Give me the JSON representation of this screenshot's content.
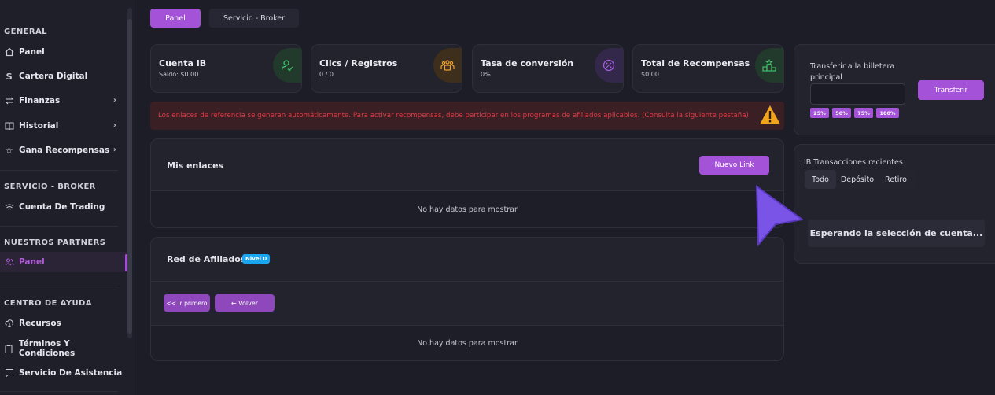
{
  "sidebar": {
    "sections": [
      {
        "title": "GENERAL"
      },
      {
        "title": "SERVICIO - BROKER"
      },
      {
        "title": "NUESTROS PARTNERS"
      },
      {
        "title": "CENTRO DE AYUDA"
      }
    ],
    "items": [
      {
        "label": "Panel",
        "icon": "home-icon"
      },
      {
        "label": "Cartera Digital",
        "icon": "dollar-icon"
      },
      {
        "label": "Finanzas",
        "icon": "exchange-icon",
        "chevron": "›"
      },
      {
        "label": "Historial",
        "icon": "book-icon",
        "chevron": "›"
      },
      {
        "label": "Gana Recompensas",
        "icon": "star-icon",
        "chevron": "›"
      },
      {
        "label": "Cuenta De Trading",
        "icon": "trading-icon"
      },
      {
        "label": "Panel",
        "icon": "partners-icon",
        "active": true
      },
      {
        "label": "Recursos",
        "icon": "download-cloud-icon"
      },
      {
        "label": "Términos Y Condiciones",
        "icon": "clipboard-icon"
      },
      {
        "label": "Servicio De Asistencia",
        "icon": "chat-icon"
      }
    ]
  },
  "tabs": [
    {
      "label": "Panel",
      "active": true
    },
    {
      "label": "Servicio - Broker",
      "active": false
    }
  ],
  "stats": [
    {
      "title": "Cuenta IB",
      "sub": "Saldo: $0.00",
      "icon": "user-check-icon",
      "color": "#3fbf6a"
    },
    {
      "title": "Clics / Registros",
      "sub": "0 / 0",
      "icon": "users-icon",
      "color": "#f2a12a"
    },
    {
      "title": "Tasa de conversión",
      "sub": "0%",
      "icon": "percent-badge-icon",
      "color": "#a45ce0"
    },
    {
      "title": "Total de Recompensas",
      "sub": "$0.00",
      "icon": "podium-icon",
      "color": "#3fbf6a"
    }
  ],
  "alert": {
    "text": "Los enlaces de referencia se generan automáticamente. Para activar recompensas, debe participar en los programas de afiliados aplicables. (Consulta la siguiente pestaña)",
    "icon": "warning-icon"
  },
  "links_panel": {
    "title": "Mis enlaces",
    "new_button": "Nuevo Link",
    "empty": "No hay datos para mostrar"
  },
  "affiliates_panel": {
    "title": "Red de Afiliados",
    "level_badge": "Nivel 0",
    "first_button": "<< Ir primero",
    "back_button": "← Volver",
    "empty": "No hay datos para mostrar"
  },
  "transfer": {
    "label": "Transferir a la billetera principal",
    "input_value": "",
    "button": "Transferir",
    "percentages": [
      "25%",
      "50%",
      "75%",
      "100%"
    ]
  },
  "transactions": {
    "title": "IB Transacciones recientes",
    "filters": [
      "Todo",
      "Depósito",
      "Retiro"
    ],
    "selected": "Todo",
    "waiting": "Esperando la selección de cuenta..."
  },
  "colors": {
    "accent": "#a453d8",
    "alert_text": "#e03a44",
    "level_badge": "#1aa6ef"
  }
}
